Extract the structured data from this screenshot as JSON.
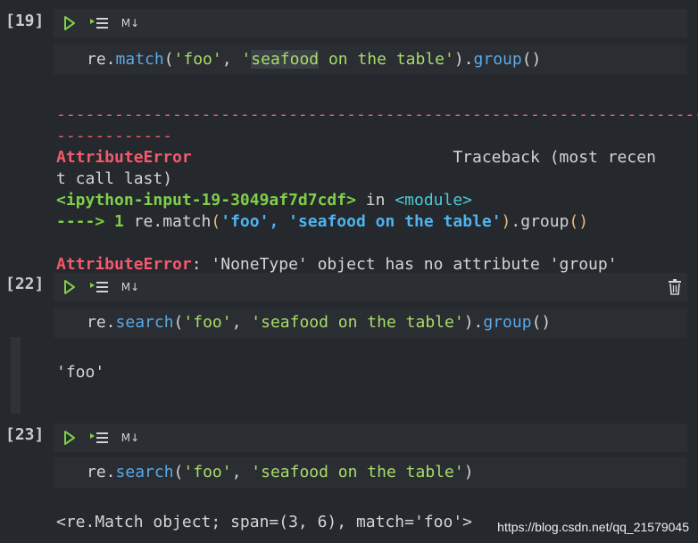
{
  "cells": [
    {
      "prompt": "[19]",
      "toolbar": {
        "run_icon": "play-icon",
        "run_by_line_icon": "run-by-line-icon",
        "markdown_label": "M↓"
      },
      "code": {
        "pre": "re.",
        "fn": "match",
        "open": "(",
        "s1": "'foo'",
        "comma": ", ",
        "s2a": "'",
        "s2b": "seafood",
        "s2c": " on the table'",
        "close": ").",
        "fn2": "group",
        "end": "()"
      },
      "error": {
        "dashes1": "---------------------------------------------------------------------",
        "dashes2": "------------",
        "name": "AttributeError",
        "traceback_label": "Traceback (most recen",
        "traceback_cont": "t call last)",
        "input_ref": "<ipython-input-19-3049af7d7cdf>",
        "in_word": " in ",
        "module": "<module>",
        "arrow": "----> 1 ",
        "frame_pre": "re.match",
        "frame_paren_open": "(",
        "frame_s1": "'foo'",
        "frame_comma": ", ",
        "frame_s2": "'seafood on the table'",
        "frame_paren_close": ")",
        "frame_dot": ".group",
        "frame_end": "()",
        "final_name": "AttributeError",
        "final_msg": ": 'NoneType' object has no attribute 'group'"
      }
    },
    {
      "prompt": "[22]",
      "toolbar": {
        "run_icon": "play-icon",
        "run_by_line_icon": "run-by-line-icon",
        "markdown_label": "M↓",
        "delete_icon": "trash-icon"
      },
      "code": {
        "pre": "re.",
        "fn": "search",
        "open": "(",
        "s1": "'foo'",
        "comma": ", ",
        "s2": "'seafood on the table'",
        "close": ").",
        "fn2": "group",
        "end": "()"
      },
      "output": "'foo'"
    },
    {
      "prompt": "[23]",
      "toolbar": {
        "run_icon": "play-icon",
        "run_by_line_icon": "run-by-line-icon",
        "markdown_label": "M↓"
      },
      "code": {
        "pre": "re.",
        "fn": "search",
        "open": "(",
        "s1": "'foo'",
        "comma": ", ",
        "s2": "'seafood on the table'",
        "end": ")"
      },
      "output": "<re.Match object; span=(3, 6), match='foo'>"
    }
  ],
  "watermark": "https://blog.csdn.net/qq_21579045",
  "colors": {
    "background": "#25282c",
    "function": "#5aa9e6",
    "string": "#a7dc6a",
    "error": "#f5596b"
  }
}
